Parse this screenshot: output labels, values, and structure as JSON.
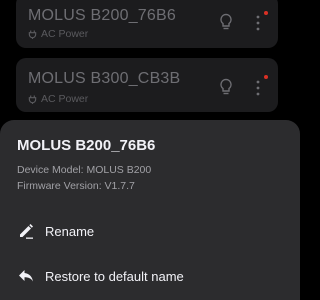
{
  "devices": [
    {
      "name": "MOLUS B200_76B6",
      "power": "AC Power",
      "icon": "bulb-icon",
      "notification": true
    },
    {
      "name": "MOLUS B300_CB3B",
      "power": "AC Power",
      "icon": "bulb-icon",
      "notification": true
    }
  ],
  "sheet": {
    "title": "MOLUS B200_76B6",
    "device_model": "Device Model: MOLUS B200",
    "firmware_version": "Firmware Version: V1.7.7",
    "actions": [
      {
        "label": "Rename",
        "icon": "pencil-icon"
      },
      {
        "label": "Restore to default name",
        "icon": "reply-arrow-icon"
      }
    ]
  },
  "colors": {
    "background": "#000000",
    "card": "#1c1c1e",
    "sheet": "#2c2c2e",
    "notification_dot": "#d93025"
  }
}
